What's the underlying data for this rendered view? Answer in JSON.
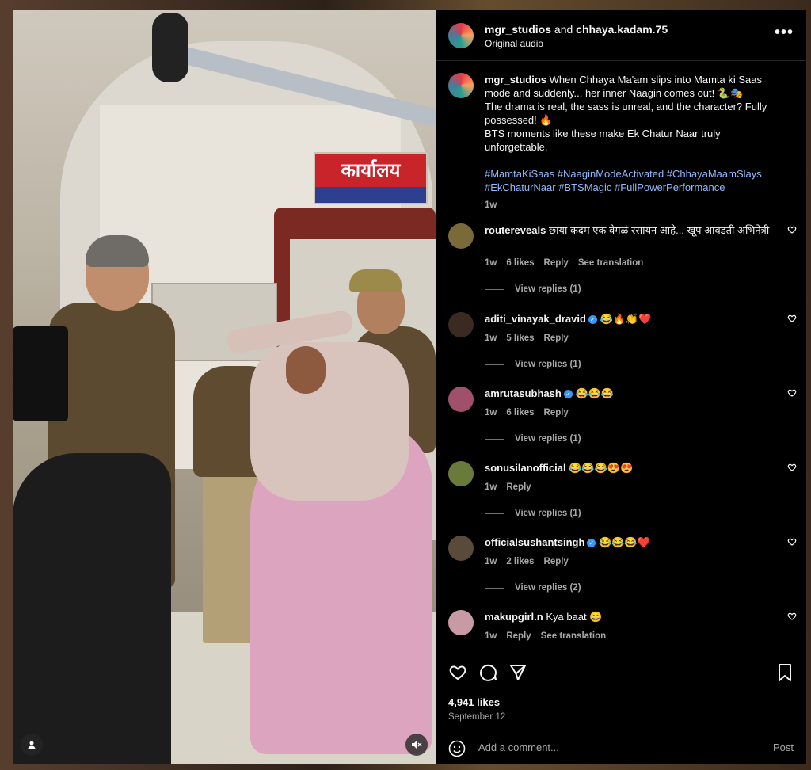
{
  "header": {
    "user1": "mgr_studios",
    "and_text": "and",
    "user2": "chhaya.kadam.75",
    "subtitle": "Original audio",
    "more_icon": "more-horizontal-icon"
  },
  "media": {
    "sign_text": "कार्यालय",
    "user_tag_icon": "person-icon",
    "mute_icon": "muted-speaker-icon"
  },
  "caption": {
    "username": "mgr_studios",
    "line1": "When Chhaya Ma'am slips into Mamta ki Saas mode and suddenly... her inner Naagin comes out! 🐍🎭",
    "line2": "The drama is real, the sass is unreal, and the character? Fully possessed! 🔥",
    "line3": "BTS moments like these make Ek Chatur Naar truly unforgettable.",
    "hashtags": "#MamtaKiSaas #NaaginModeActivated #ChhayaMaamSlays #EkChaturNaar #BTSMagic #FullPowerPerformance",
    "time": "1w"
  },
  "comments": [
    {
      "username": "routereveals",
      "text": "छाया कदम एक वेगळं रसायन आहे... खूप आवडती अभिनेत्री",
      "time": "1w",
      "likes": "6 likes",
      "reply": "Reply",
      "translate": "See translation",
      "view_replies": "View replies (1)",
      "verified": false
    },
    {
      "username": "aditi_vinayak_dravid",
      "text": "😂🔥👏❤️",
      "time": "1w",
      "likes": "5 likes",
      "reply": "Reply",
      "translate": "",
      "view_replies": "View replies (1)",
      "verified": true
    },
    {
      "username": "amrutasubhash",
      "text": "😂😂😂",
      "time": "1w",
      "likes": "6 likes",
      "reply": "Reply",
      "translate": "",
      "view_replies": "View replies (1)",
      "verified": true
    },
    {
      "username": "sonusilanofficial",
      "text": "😂😂😂😍😍",
      "time": "1w",
      "likes": "",
      "reply": "Reply",
      "translate": "",
      "view_replies": "View replies (1)",
      "verified": false
    },
    {
      "username": "officialsushantsingh",
      "text": "😂😂😂❤️",
      "time": "1w",
      "likes": "2 likes",
      "reply": "Reply",
      "translate": "",
      "view_replies": "View replies (2)",
      "verified": true
    },
    {
      "username": "makupgirl.n",
      "text": "Kya baat 😄",
      "time": "1w",
      "likes": "",
      "reply": "Reply",
      "translate": "See translation",
      "view_replies": "",
      "verified": false
    }
  ],
  "actions": {
    "like_icon": "heart-icon",
    "comment_icon": "comment-icon",
    "share_icon": "send-icon",
    "save_icon": "bookmark-icon",
    "likes_count": "4,941 likes",
    "date": "September 12",
    "add_comment_placeholder": "Add a comment...",
    "post_label": "Post",
    "emoji_icon": "emoji-icon"
  }
}
